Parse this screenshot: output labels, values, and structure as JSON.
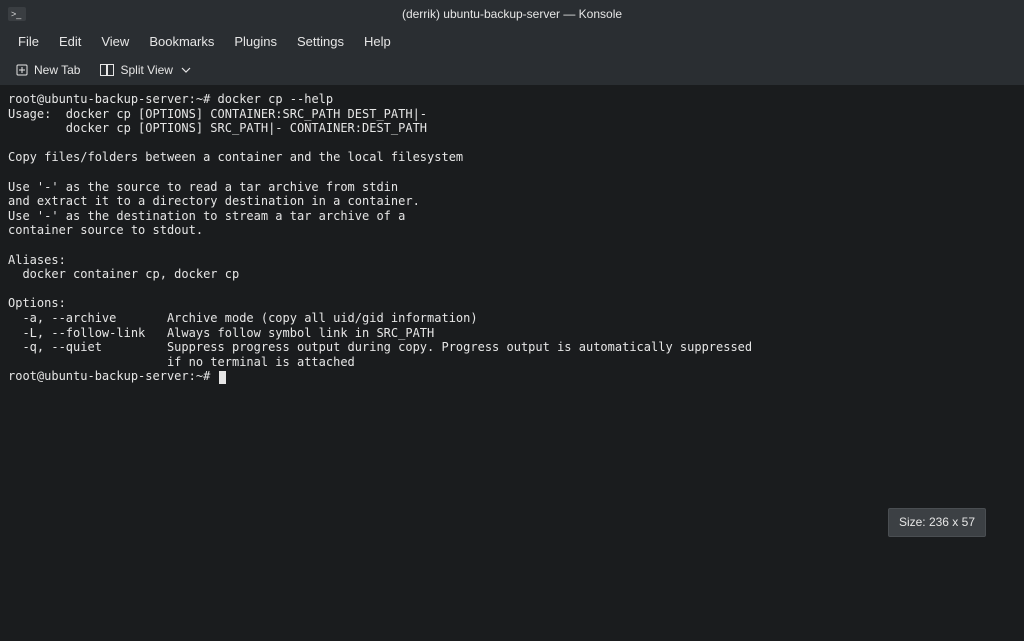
{
  "titlebar": {
    "icon_glyph": ">_",
    "title": "(derrik) ubuntu-backup-server — Konsole"
  },
  "menubar": {
    "items": [
      "File",
      "Edit",
      "View",
      "Bookmarks",
      "Plugins",
      "Settings",
      "Help"
    ]
  },
  "toolbar": {
    "new_tab": "New Tab",
    "split_view": "Split View"
  },
  "terminal": {
    "prompt1": "root@ubuntu-backup-server:~#",
    "command1": " docker cp --help",
    "body": "\nUsage:  docker cp [OPTIONS] CONTAINER:SRC_PATH DEST_PATH|-\n        docker cp [OPTIONS] SRC_PATH|- CONTAINER:DEST_PATH\n\nCopy files/folders between a container and the local filesystem\n\nUse '-' as the source to read a tar archive from stdin\nand extract it to a directory destination in a container.\nUse '-' as the destination to stream a tar archive of a\ncontainer source to stdout.\n\nAliases:\n  docker container cp, docker cp\n\nOptions:\n  -a, --archive       Archive mode (copy all uid/gid information)\n  -L, --follow-link   Always follow symbol link in SRC_PATH\n  -q, --quiet         Suppress progress output during copy. Progress output is automatically suppressed\n                      if no terminal is attached",
    "prompt2": "root@ubuntu-backup-server:~# "
  },
  "tooltip": {
    "size": "Size: 236 x 57"
  }
}
